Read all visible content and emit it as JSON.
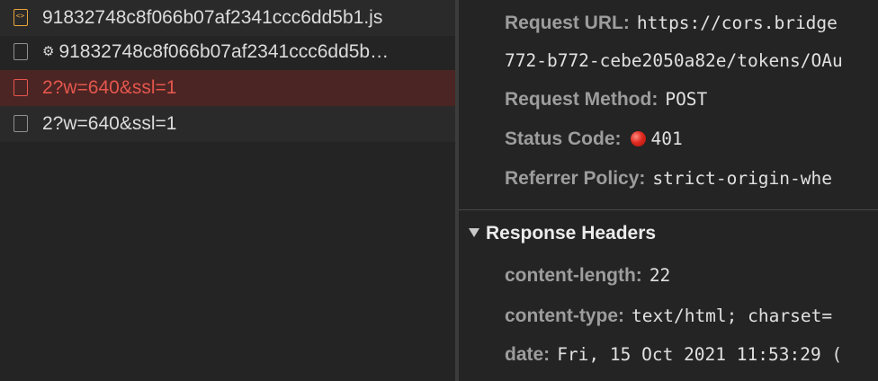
{
  "requests": [
    {
      "name": "91832748c8f066b07af2341ccc6dd5b1.js",
      "type": "script",
      "status": "normal",
      "has_gear": false
    },
    {
      "name": "91832748c8f066b07af2341ccc6dd5b…",
      "type": "document",
      "status": "normal",
      "has_gear": true
    },
    {
      "name": "2?w=640&ssl=1",
      "type": "document",
      "status": "error",
      "has_gear": false
    },
    {
      "name": "2?w=640&ssl=1",
      "type": "document",
      "status": "normal",
      "has_gear": false
    }
  ],
  "general": {
    "request_url_label": "Request URL:",
    "request_url_value": "https://cors.bridge",
    "request_url_continued": "772-b772-cebe2050a82e/tokens/OAu",
    "request_method_label": "Request Method:",
    "request_method_value": "POST",
    "status_code_label": "Status Code:",
    "status_code_value": "401",
    "status_color": "#e02a20",
    "referrer_policy_label": "Referrer Policy:",
    "referrer_policy_value": "strict-origin-whe"
  },
  "response_headers": {
    "title": "Response Headers",
    "items": [
      {
        "key": "content-length:",
        "value": "22"
      },
      {
        "key": "content-type:",
        "value": "text/html; charset="
      },
      {
        "key": "date:",
        "value": "Fri, 15 Oct 2021 11:53:29 ("
      }
    ]
  },
  "icons": {
    "js_file": "code-file-icon",
    "document": "document-icon",
    "gear": "gear-icon",
    "status": "status-dot-icon",
    "collapse": "triangle-down-icon"
  }
}
